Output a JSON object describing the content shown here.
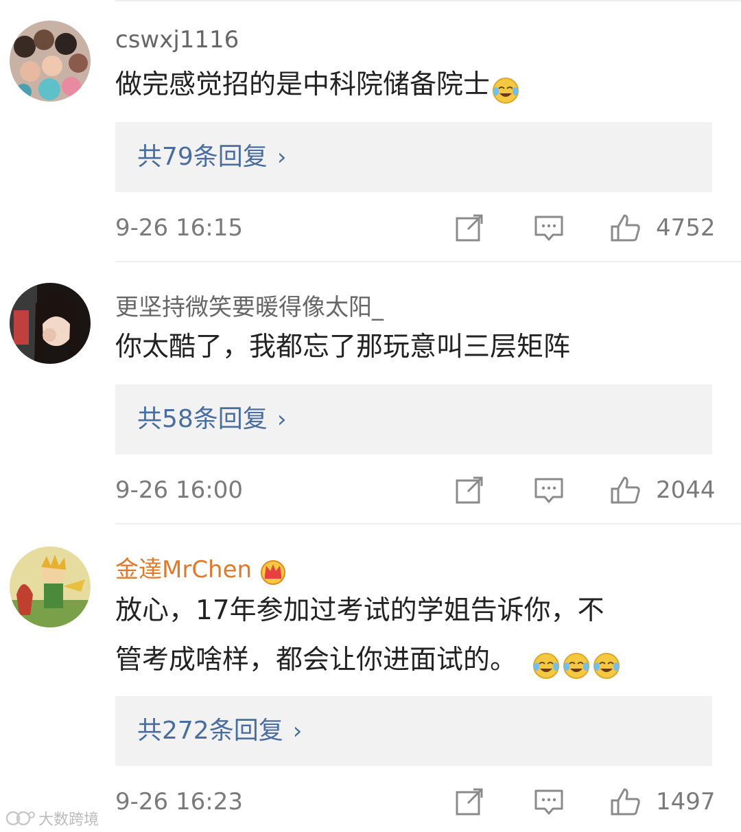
{
  "comments": [
    {
      "username": "cswxj1116",
      "text": "做完感觉招的是中科院储备院士",
      "emojis": [
        "laugh-cry-emoji"
      ],
      "replies_label": "共79条回复",
      "time": "9-26 16:15",
      "likes": "4752"
    },
    {
      "username": "更坚持微笑要暖得像太阳_",
      "text": "你太酷了，我都忘了那玩意叫三层矩阵",
      "emojis": [],
      "replies_label": "共58条回复",
      "time": "9-26 16:00",
      "likes": "2044"
    },
    {
      "username": "金達MrChen",
      "vip_badge": "crown-icon",
      "text_line1": "放心，17年参加过考试的学姐告诉你，不",
      "text_line2": "管考成啥样，都会让你进面试的。",
      "emojis": [
        "laugh-cry-emoji",
        "laugh-cry-emoji",
        "laugh-cry-emoji"
      ],
      "replies_label": "共272条回复",
      "time": "9-26 16:23",
      "likes": "1497"
    }
  ],
  "icons": {
    "share": "share-icon",
    "reply": "comment-icon",
    "like": "thumbs-up-icon",
    "chevron": "›"
  },
  "watermark": "大数跨境",
  "colors": {
    "link": "#4a6da0",
    "vip_name": "#e07a2a",
    "reply_box_bg": "#f2f2f2"
  }
}
